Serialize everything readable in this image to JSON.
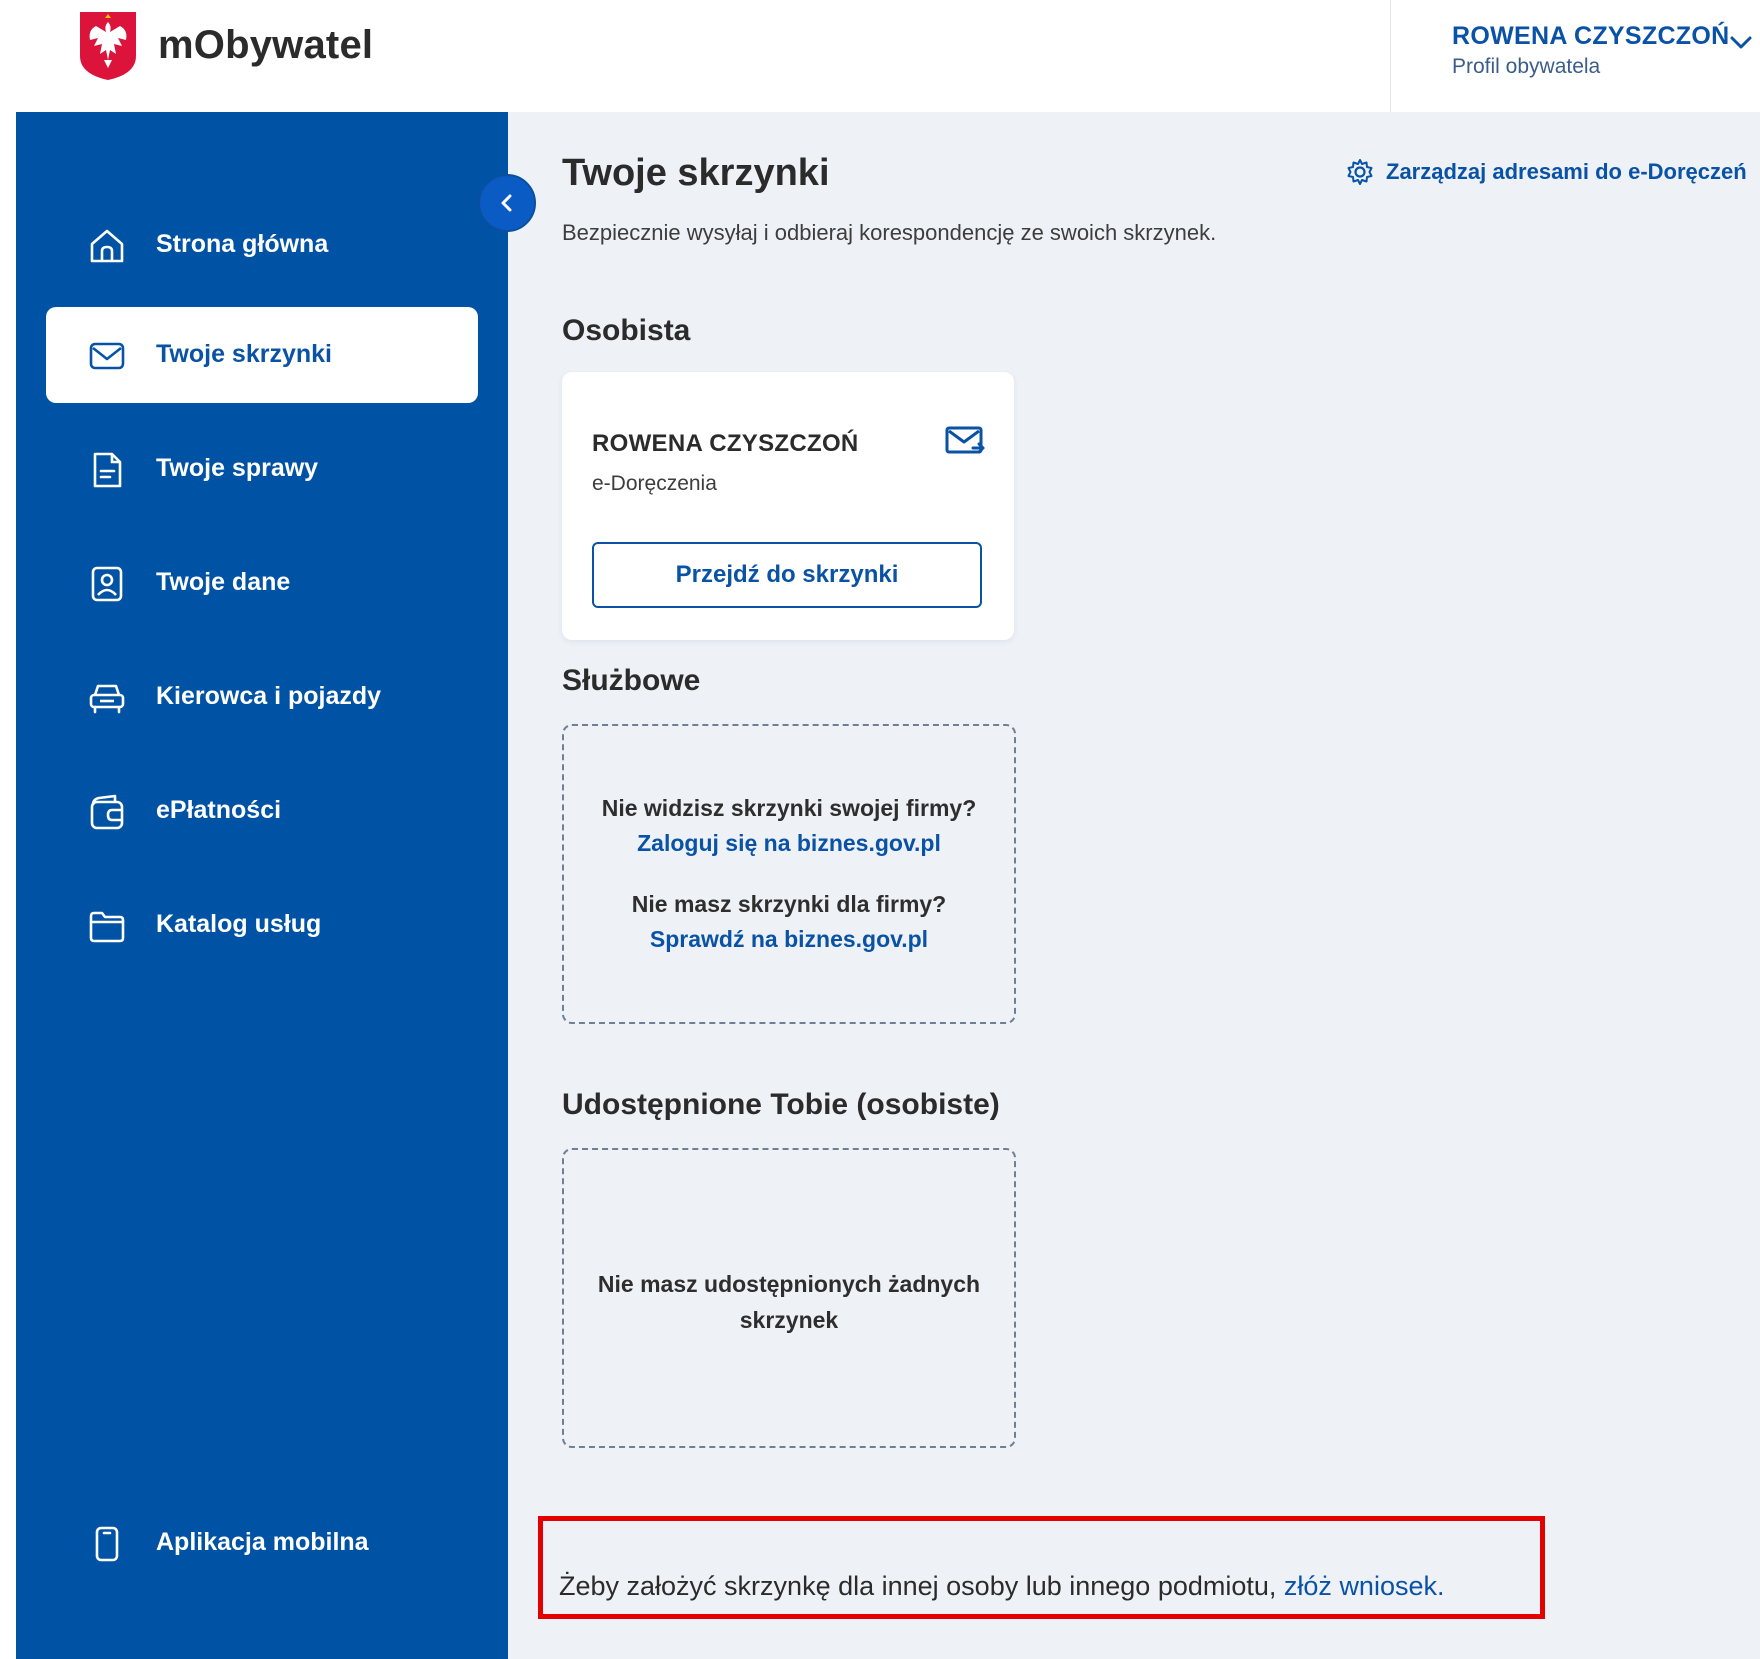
{
  "brand": {
    "name": "mObywatel",
    "logo_icon": "polish-eagle-emblem"
  },
  "user": {
    "name": "ROWENA CZYSZCZOŃ",
    "role": "Profil obywatela"
  },
  "sidebar": {
    "items": [
      {
        "label": "Strona główna",
        "icon": "home-icon",
        "active": false
      },
      {
        "label": "Twoje skrzynki",
        "icon": "envelope-icon",
        "active": true
      },
      {
        "label": "Twoje sprawy",
        "icon": "document-icon",
        "active": false
      },
      {
        "label": "Twoje dane",
        "icon": "id-card-icon",
        "active": false
      },
      {
        "label": "Kierowca i pojazdy",
        "icon": "car-icon",
        "active": false
      },
      {
        "label": "ePłatności",
        "icon": "wallet-icon",
        "active": false
      },
      {
        "label": "Katalog usług",
        "icon": "folder-icon",
        "active": false
      }
    ],
    "bottom_item": {
      "label": "Aplikacja mobilna",
      "icon": "phone-icon"
    }
  },
  "main": {
    "title": "Twoje skrzynki",
    "manage_link": "Zarządzaj adresami do e-Doręczeń",
    "subtitle": "Bezpiecznie wysyłaj i odbieraj korespondencję ze swoich skrzynek.",
    "personal": {
      "heading": "Osobista",
      "card": {
        "owner": "ROWENA CZYSZCZOŃ",
        "type": "e-Doręczenia",
        "button": "Przejdź do skrzynki"
      }
    },
    "business": {
      "heading": "Służbowe",
      "q1": "Nie widzisz skrzynki swojej firmy?",
      "link1": "Zaloguj się na biznes.gov.pl",
      "q2": "Nie masz skrzynki dla firmy?",
      "link2": "Sprawdź na biznes.gov.pl"
    },
    "shared": {
      "heading": "Udostępnione Tobie (osobiste)",
      "empty_line1": "Nie masz udostępnionych żadnych",
      "empty_line2": "skrzynek"
    },
    "notice": {
      "text": "Żeby założyć skrzynkę dla innej osoby lub innego podmiotu,",
      "link": "złóż wniosek."
    }
  },
  "colors": {
    "sidebar_bg": "#0052a5",
    "accent": "#0a52a6",
    "main_bg": "#eef2f7",
    "highlight_border": "#e30000"
  }
}
